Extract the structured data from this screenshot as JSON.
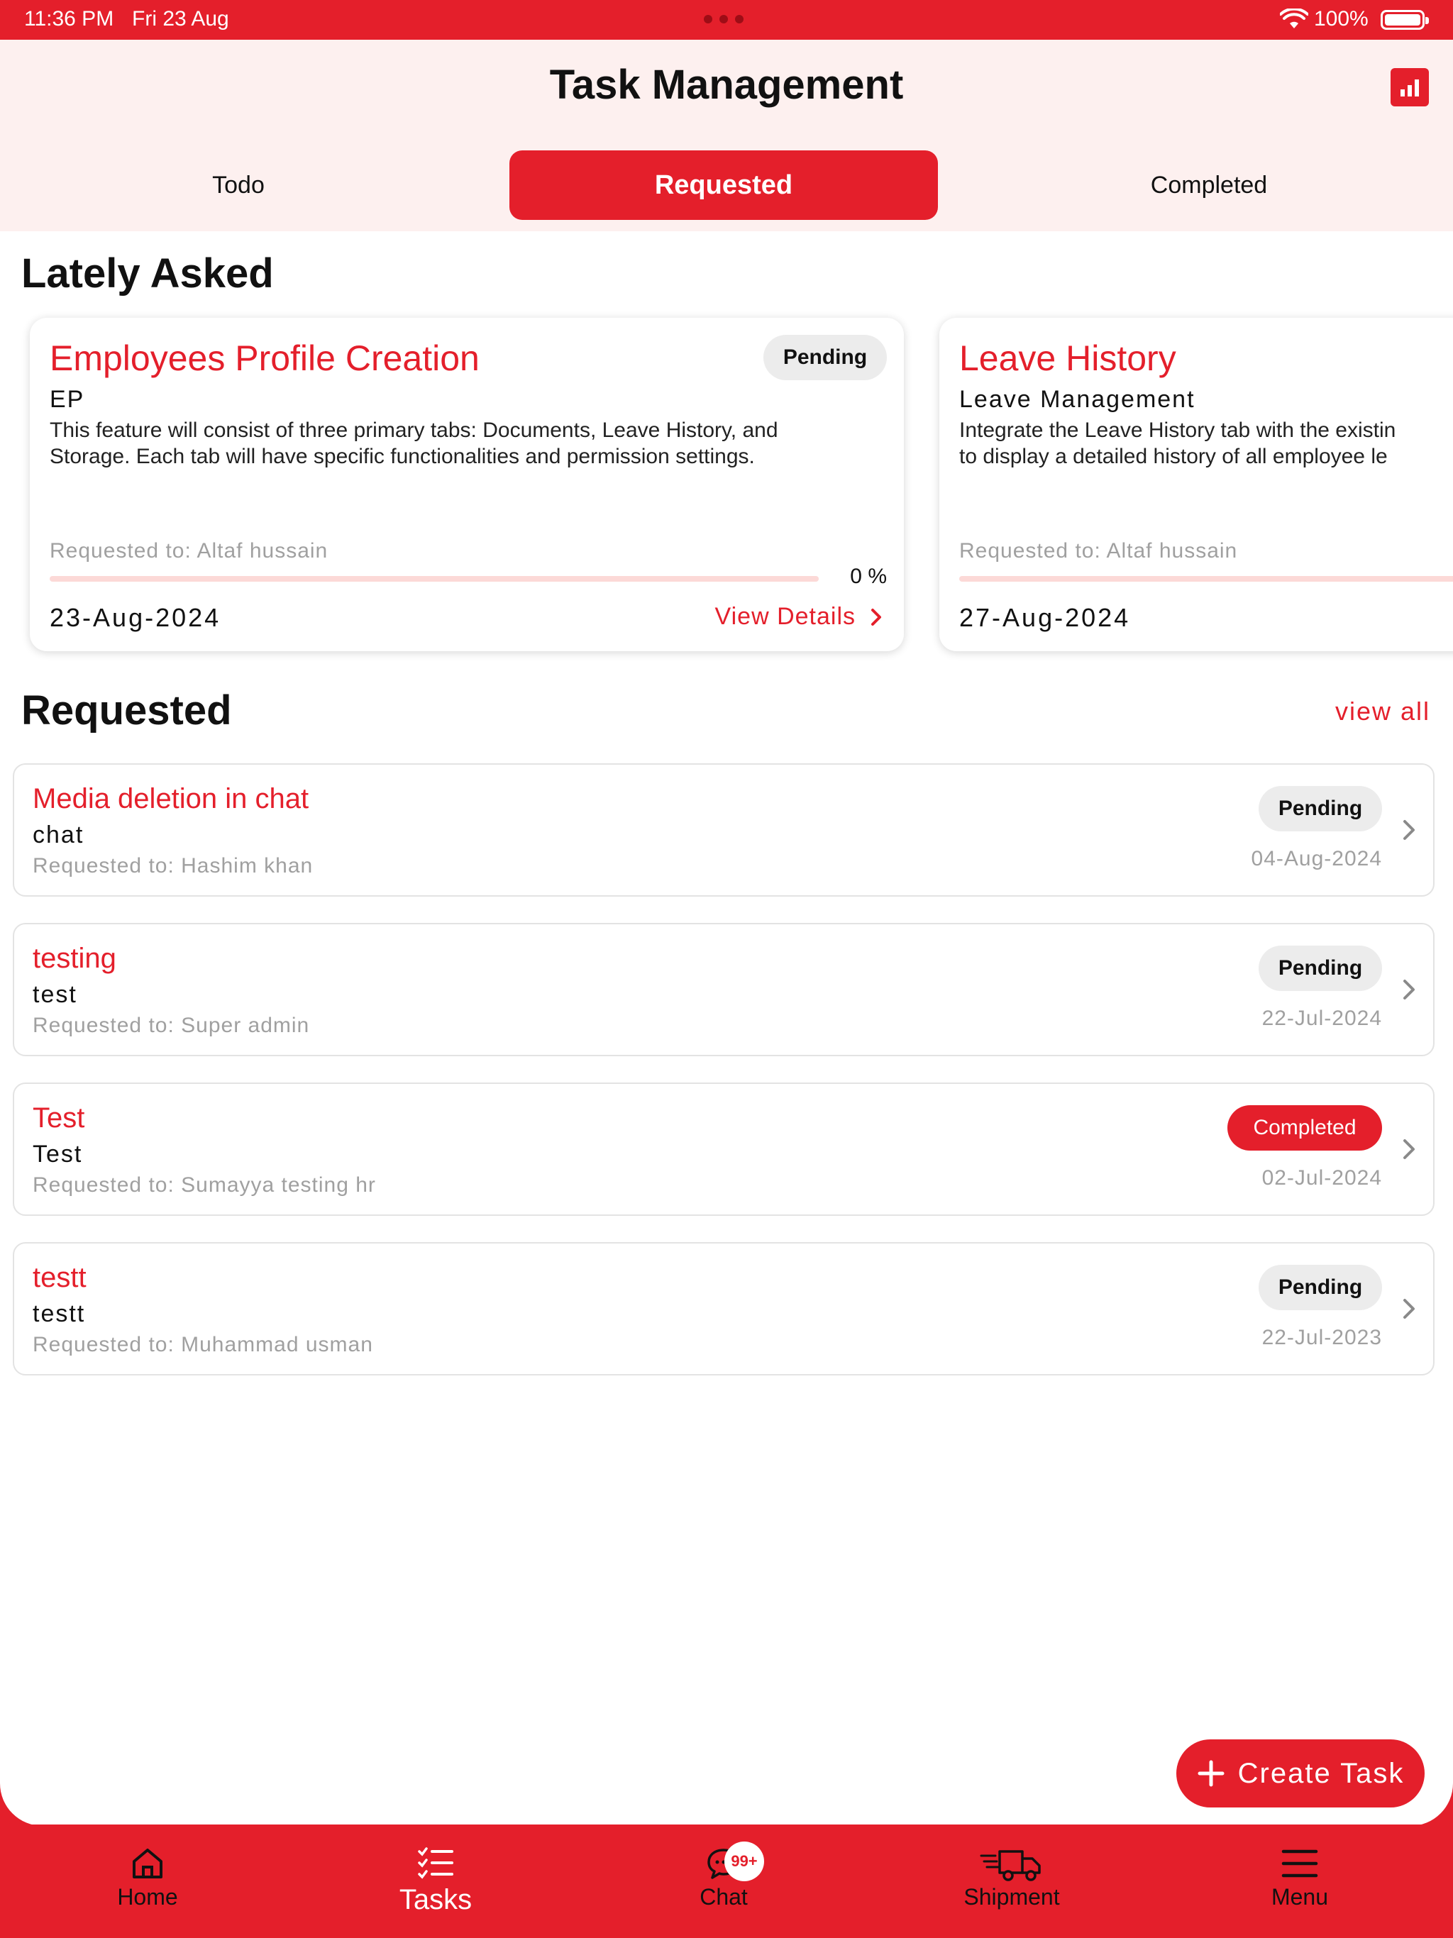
{
  "status_bar": {
    "time": "11:36 PM",
    "date": "Fri 23 Aug",
    "battery": "100%"
  },
  "header": {
    "title": "Task Management",
    "chart_icon": "bar-chart-icon"
  },
  "tabs": [
    {
      "label": "Todo"
    },
    {
      "label": "Requested"
    },
    {
      "label": "Completed"
    }
  ],
  "lately_asked": {
    "title": "Lately Asked",
    "cards": [
      {
        "title": "Employees Profile Creation",
        "status": "Pending",
        "category": "EP",
        "description_line1": "This feature will consist of three primary tabs: Documents, Leave History, and",
        "description_line2": "Storage. Each tab will have specific functionalities and permission settings.",
        "requested_to": "Requested to: Altaf hussain",
        "progress": 0,
        "progress_label": "0 %",
        "date": "23-Aug-2024",
        "action": "View Details"
      },
      {
        "title": "Leave History",
        "category": "Leave Management",
        "description_line1": "Integrate the Leave History tab with the existin",
        "description_line2": "to display a detailed history of all employee le",
        "requested_to": "Requested to: Altaf hussain",
        "date": "27-Aug-2024"
      }
    ]
  },
  "requested": {
    "title": "Requested",
    "view_all": "view all",
    "items": [
      {
        "title": "Media deletion in chat",
        "subtitle": "chat",
        "requested_to": "Requested to: Hashim khan",
        "status": "Pending",
        "date": "04-Aug-2024"
      },
      {
        "title": "testing",
        "subtitle": "test",
        "requested_to": "Requested to: Super admin",
        "status": "Pending",
        "date": "22-Jul-2024"
      },
      {
        "title": "Test",
        "subtitle": "Test",
        "requested_to": "Requested to: Sumayya testing hr",
        "status": "Completed",
        "date": "02-Jul-2024"
      },
      {
        "title": "testt",
        "subtitle": "testt",
        "requested_to": "Requested to: Muhammad usman",
        "status": "Pending",
        "date": "22-Jul-2023"
      }
    ]
  },
  "fab": {
    "label": "Create Task"
  },
  "bottom_nav": [
    {
      "label": "Home",
      "icon": "home-icon"
    },
    {
      "label": "Tasks",
      "icon": "tasks-icon",
      "active": true
    },
    {
      "label": "Chat",
      "icon": "chat-icon",
      "badge": "99+"
    },
    {
      "label": "Shipment",
      "icon": "truck-icon"
    },
    {
      "label": "Menu",
      "icon": "menu-icon"
    }
  ],
  "colors": {
    "accent": "#e41f2b",
    "header_bg": "#fdf0ef",
    "badge_bg": "#ececec",
    "progress_track": "#fcd9d7"
  }
}
